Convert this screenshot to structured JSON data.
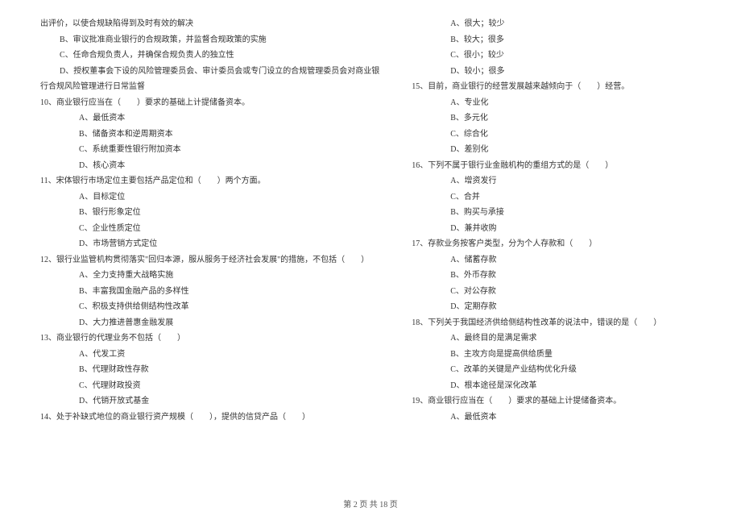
{
  "left": {
    "intro1": "出评价，以使合规缺陷得到及时有效的解决",
    "intro2": "B、审议批准商业银行的合规政策，并监督合规政策的实施",
    "intro3": "C、任命合规负责人，并确保合规负责人的独立性",
    "intro4": "D、授权董事会下设的风险管理委员会、审计委员会或专门设立的合规管理委员会对商业银",
    "intro5": "行合规风险管理进行日常监督",
    "q10": "10、商业银行应当在（　　）要求的基础上计提储备资本。",
    "q10a": "A、最低资本",
    "q10b": "B、储备资本和逆周期资本",
    "q10c": "C、系统重要性银行附加资本",
    "q10d": "D、核心资本",
    "q11": "11、宋体银行市场定位主要包括产品定位和（　　）两个方面。",
    "q11a": "A、目标定位",
    "q11b": "B、银行形象定位",
    "q11c": "C、企业性质定位",
    "q11d": "D、市场营销方式定位",
    "q12": "12、银行业监管机构贯彻落实\"回归本源，服从服务于经济社会发展\"的措施，不包括（　　）",
    "q12a": "A、全力支持重大战略实施",
    "q12b": "B、丰富我国金融产品的多样性",
    "q12c": "C、积极支持供给侧结构性改革",
    "q12d": "D、大力推进普惠金融发展",
    "q13": "13、商业银行的代理业务不包括（　　）",
    "q13a": "A、代发工资",
    "q13b": "B、代理财政性存款",
    "q13c": "C、代理财政投资",
    "q13d": "D、代销开放式基金",
    "q14": "14、处于补缺式地位的商业银行资产规模（　　），提供的信贷产品（　　）"
  },
  "right": {
    "q14a": "A、很大；较少",
    "q14b": "B、较大；很多",
    "q14c": "C、很小；较少",
    "q14d": "D、较小；很多",
    "q15": "15、目前，商业银行的经营发展越来越倾向于（　　）经营。",
    "q15a": "A、专业化",
    "q15b": "B、多元化",
    "q15c": "C、综合化",
    "q15d": "D、差别化",
    "q16": "16、下列不属于银行业金融机构的重组方式的是（　　）",
    "q16a": "A、增资发行",
    "q16b": "C、合并",
    "q16c": "B、购买与承接",
    "q16d": "D、兼并收购",
    "q17": "17、存款业务按客户类型，分为个人存款和（　　）",
    "q17a": "A、储蓄存款",
    "q17b": "B、外币存款",
    "q17c": "C、对公存款",
    "q17d": "D、定期存款",
    "q18": "18、下列关于我国经济供给侧结构性改革的说法中，错误的是（　　）",
    "q18a": "A、最终目的是满足需求",
    "q18b": "B、主攻方向是提高供给质量",
    "q18c": "C、改革的关键是产业结构优化升级",
    "q18d": "D、根本途径是深化改革",
    "q19": "19、商业银行应当在（　　）要求的基础上计提储备资本。",
    "q19a": "A、最低资本"
  },
  "footer": "第 2 页 共 18 页"
}
